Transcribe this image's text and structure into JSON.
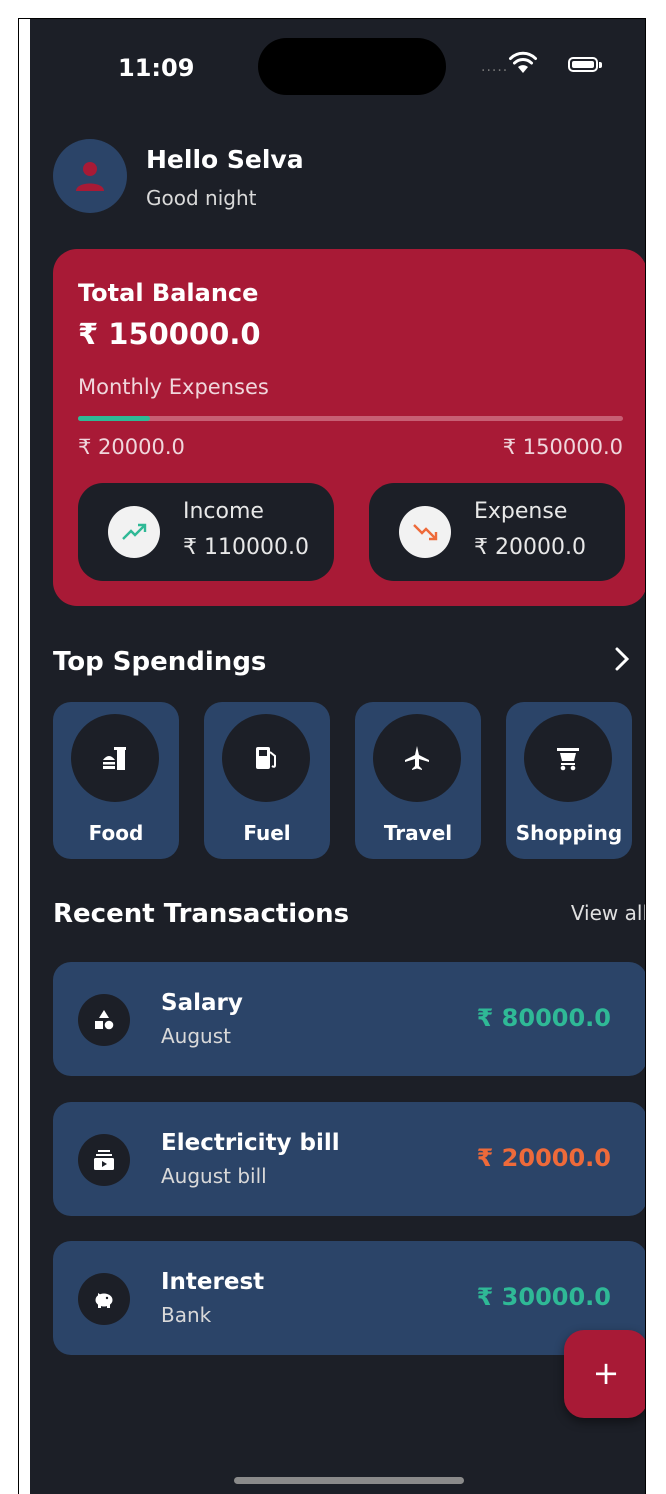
{
  "status_bar": {
    "time": "11:09",
    "dots": "....."
  },
  "header": {
    "greeting": "Hello Selva",
    "subtitle": "Good night"
  },
  "balance_card": {
    "title": "Total Balance",
    "amount": "₹ 150000.0",
    "monthly_label": "Monthly Expenses",
    "spent": "₹ 20000.0",
    "limit": "₹ 150000.0",
    "progress_fraction": 0.133,
    "income": {
      "label": "Income",
      "value": "₹ 110000.0"
    },
    "expense": {
      "label": "Expense",
      "value": "₹ 20000.0"
    }
  },
  "top_spendings": {
    "title": "Top Spendings",
    "categories": [
      {
        "label": "Food",
        "icon": "fastfood-icon"
      },
      {
        "label": "Fuel",
        "icon": "fuel-pump-icon"
      },
      {
        "label": "Travel",
        "icon": "airplane-icon"
      },
      {
        "label": "Shopping",
        "icon": "shopping-cart-icon"
      }
    ]
  },
  "recent": {
    "title": "Recent Transactions",
    "view_all": "View all",
    "items": [
      {
        "name": "Salary",
        "sub": "August",
        "amount": "₹ 80000.0",
        "type": "income",
        "icon": "category-shapes-icon"
      },
      {
        "name": "Electricity bill",
        "sub": "August bill",
        "amount": "₹ 20000.0",
        "type": "expense",
        "icon": "subscriptions-icon"
      },
      {
        "name": "Interest",
        "sub": "Bank",
        "amount": "₹ 30000.0",
        "type": "income",
        "icon": "piggy-bank-icon"
      }
    ]
  },
  "fab": {
    "label": "+"
  },
  "colors": {
    "background": "#1c1f27",
    "card_accent": "#a81a36",
    "tile": "#2b4468",
    "income": "#2fb996",
    "expense": "#ee6a3a"
  }
}
